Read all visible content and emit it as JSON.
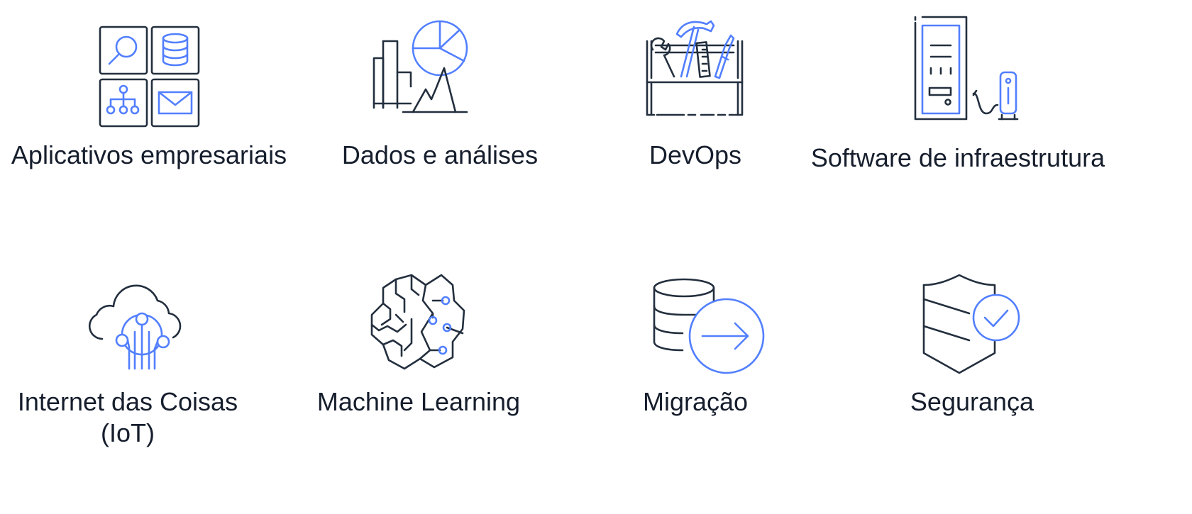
{
  "categories": [
    {
      "label": "Aplicativos empresariais",
      "icon": "business-apps-icon"
    },
    {
      "label": "Dados e análises",
      "icon": "data-analytics-icon"
    },
    {
      "label": "DevOps",
      "icon": "devops-toolbox-icon"
    },
    {
      "label": "Software de infraestrutura",
      "icon": "infrastructure-server-icon"
    },
    {
      "label": "Internet das Coisas",
      "label_line2": "(IoT)",
      "icon": "iot-cloud-icon"
    },
    {
      "label": "Machine Learning",
      "icon": "machine-learning-brain-icon"
    },
    {
      "label": "Migração",
      "icon": "migration-database-arrow-icon"
    },
    {
      "label": "Segurança",
      "icon": "security-shield-icon"
    }
  ],
  "colors": {
    "icon_dark": "#232f3e",
    "icon_accent": "#527fff",
    "text": "#161e2d",
    "background": "#ffffff"
  }
}
